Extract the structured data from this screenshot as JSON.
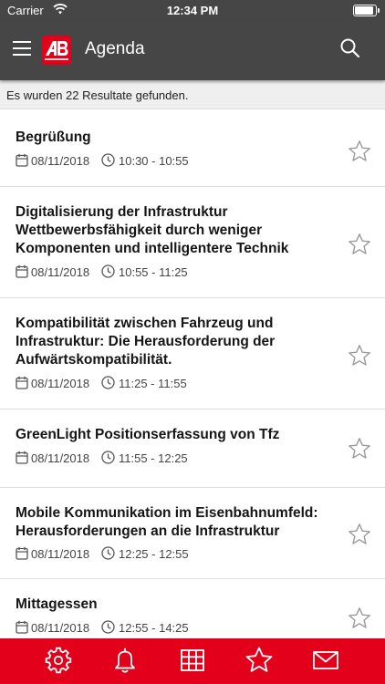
{
  "status_bar": {
    "carrier": "Carrier",
    "time": "12:34 PM",
    "wifi_icon": "wifi-icon",
    "battery_icon": "battery-icon",
    "battery_level": 1.0
  },
  "nav_bar": {
    "title": "Agenda",
    "logo_icon": "app-logo",
    "menu_icon": "hamburger-icon",
    "search_icon": "search-icon",
    "background_color": "#464646"
  },
  "results": {
    "text": "Es wurden 22 Resultate gefunden."
  },
  "agenda_items": [
    {
      "title": "Begrüßung",
      "date": "08/11/2018",
      "time": "10:30 - 10:55",
      "favorited": false
    },
    {
      "title": "Digitalisierung der Infrastruktur Wettbewerbsfähigkeit durch weniger Komponenten und intelligentere Technik",
      "date": "08/11/2018",
      "time": "10:55 - 11:25",
      "favorited": false
    },
    {
      "title": "Kompatibilität zwischen Fahrzeug und Infrastruktur: Die Herausforderung der Aufwärtskompatibilität.",
      "date": "08/11/2018",
      "time": "11:25 - 11:55",
      "favorited": false
    },
    {
      "title": "GreenLight Positionserfassung von Tfz",
      "date": "08/11/2018",
      "time": "11:55 - 12:25",
      "favorited": false
    },
    {
      "title": "Mobile Kommunikation im Eisenbahnumfeld: Herausforderungen an die Infrastruktur",
      "date": "08/11/2018",
      "time": "12:25 - 12:55",
      "favorited": false
    },
    {
      "title": "Mittagessen",
      "date": "08/11/2018",
      "time": "12:55 - 14:25",
      "favorited": false
    }
  ],
  "tab_bar": {
    "background_color": "#e3001b",
    "tabs": [
      {
        "icon": "gear-icon"
      },
      {
        "icon": "bell-icon"
      },
      {
        "icon": "grid-icon"
      },
      {
        "icon": "star-icon"
      },
      {
        "icon": "mail-icon"
      }
    ]
  },
  "colors": {
    "accent": "#e3001b",
    "header": "#464646",
    "star_outline": "#9a9a9a"
  }
}
